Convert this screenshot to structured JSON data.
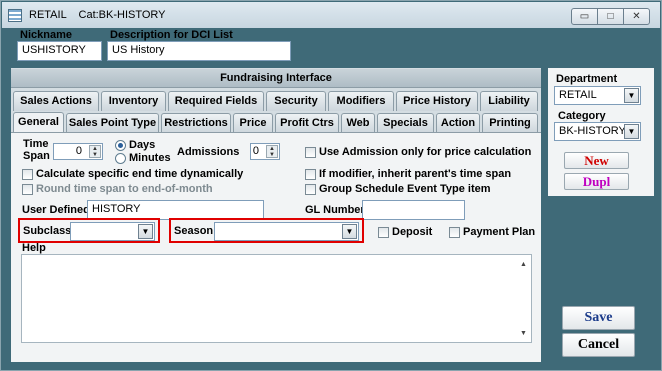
{
  "window": {
    "title": "RETAIL    Cat:BK-HISTORY",
    "controls": [
      "minimize",
      "maximize",
      "close"
    ]
  },
  "header": {
    "nickname_label": "Nickname",
    "nickname_value": "USHISTORY",
    "description_label": "Description for DCI List",
    "description_value": "US History"
  },
  "fund_bar": "Fundraising Interface",
  "tabs_row1": [
    "Sales Actions",
    "Inventory",
    "Required Fields",
    "Security",
    "Modifiers",
    "Price History",
    "Liability"
  ],
  "tabs_row2": [
    "General",
    "Sales Point Type",
    "Restrictions",
    "Price",
    "Profit Ctrs",
    "Web",
    "Specials",
    "Action",
    "Printing"
  ],
  "active_tab": "General",
  "general": {
    "time_span_label": "Time\nSpan",
    "time_span_value": "0",
    "days_label": "Days",
    "minutes_label": "Minutes",
    "admissions_label": "Admissions",
    "admissions_value": "0",
    "use_admission_label": "Use Admission only for price calculation",
    "calc_end_label": "Calculate specific end time dynamically",
    "round_label": "Round time span to end-of-month",
    "if_modifier_label": "If modifier, inherit parent's time span",
    "group_schedule_label": "Group Schedule Event Type item",
    "user_defined_label": "User Defined",
    "user_defined_value": "HISTORY",
    "gl_number_label": "GL Number",
    "gl_number_value": "",
    "subclass_label": "Subclass",
    "subclass_value": "",
    "season_label": "Season",
    "season_value": "",
    "deposit_label": "Deposit",
    "payment_plan_label": "Payment Plan",
    "help_label": "Help",
    "help_text": ""
  },
  "right_panel": {
    "department_label": "Department",
    "department_value": "RETAIL",
    "category_label": "Category",
    "category_value": "BK-HISTORY",
    "new_label": "New",
    "dupl_label": "Dupl",
    "new_color": "#d00000",
    "dupl_color": "#c000c0"
  },
  "footer": {
    "save_label": "Save",
    "cancel_label": "Cancel",
    "save_color": "#1a3a8a"
  }
}
